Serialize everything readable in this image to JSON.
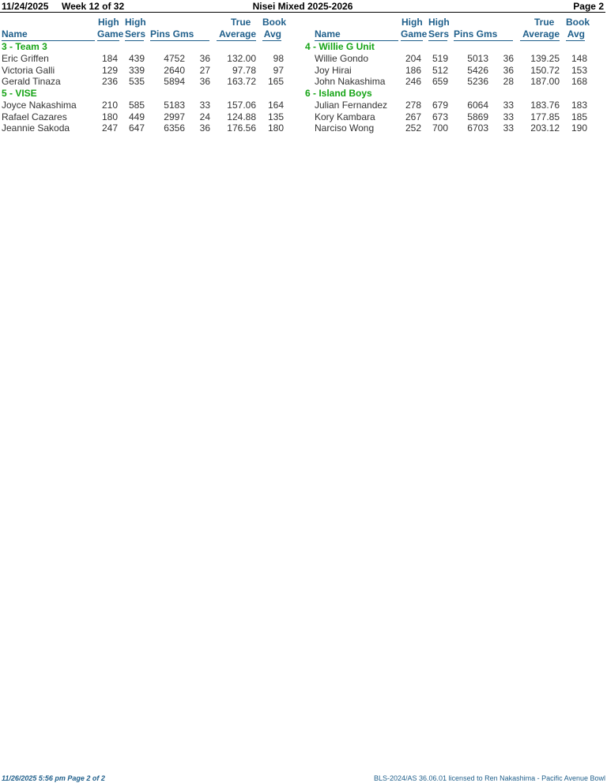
{
  "header": {
    "date": "11/24/2025",
    "week": "Week 12 of 32",
    "league": "Nisei Mixed 2025-2026",
    "page": "Page 2"
  },
  "columns_header": {
    "name": "Name",
    "high_game_1": "High",
    "high_game_2": "Game",
    "high_sers_1": "High",
    "high_sers_2": "Sers",
    "pins_gms": "Pins  Gms",
    "true_avg_1": "True",
    "true_avg_2": "Average",
    "book_avg_1": "Book",
    "book_avg_2": "Avg"
  },
  "left": {
    "teams": [
      {
        "title": "3 - Team 3",
        "players": [
          {
            "name": "Eric Griffen",
            "hg": "184",
            "hs": "439",
            "pins": "4752",
            "gms": "36",
            "avg": "132.00",
            "book": "98"
          },
          {
            "name": "Victoria Galli",
            "hg": "129",
            "hs": "339",
            "pins": "2640",
            "gms": "27",
            "avg": "97.78",
            "book": "97"
          },
          {
            "name": "Gerald Tinaza",
            "hg": "236",
            "hs": "535",
            "pins": "5894",
            "gms": "36",
            "avg": "163.72",
            "book": "165"
          }
        ]
      },
      {
        "title": "5 - VISE",
        "players": [
          {
            "name": "Joyce Nakashima",
            "hg": "210",
            "hs": "585",
            "pins": "5183",
            "gms": "33",
            "avg": "157.06",
            "book": "164"
          },
          {
            "name": "Rafael Cazares",
            "hg": "180",
            "hs": "449",
            "pins": "2997",
            "gms": "24",
            "avg": "124.88",
            "book": "135"
          },
          {
            "name": "Jeannie Sakoda",
            "hg": "247",
            "hs": "647",
            "pins": "6356",
            "gms": "36",
            "avg": "176.56",
            "book": "180"
          }
        ]
      }
    ]
  },
  "right": {
    "teams": [
      {
        "title": "4 - Willie G Unit",
        "players": [
          {
            "name": "Willie Gondo",
            "hg": "204",
            "hs": "519",
            "pins": "5013",
            "gms": "36",
            "avg": "139.25",
            "book": "148"
          },
          {
            "name": "Joy Hirai",
            "hg": "186",
            "hs": "512",
            "pins": "5426",
            "gms": "36",
            "avg": "150.72",
            "book": "153"
          },
          {
            "name": "John Nakashima",
            "hg": "246",
            "hs": "659",
            "pins": "5236",
            "gms": "28",
            "avg": "187.00",
            "book": "168"
          }
        ]
      },
      {
        "title": "6 - Island Boys",
        "players": [
          {
            "name": "Julian Fernandez",
            "hg": "278",
            "hs": "679",
            "pins": "6064",
            "gms": "33",
            "avg": "183.76",
            "book": "183"
          },
          {
            "name": "Kory Kambara",
            "hg": "267",
            "hs": "673",
            "pins": "5869",
            "gms": "33",
            "avg": "177.85",
            "book": "185"
          },
          {
            "name": "Narciso Wong",
            "hg": "252",
            "hs": "700",
            "pins": "6703",
            "gms": "33",
            "avg": "203.12",
            "book": "190"
          }
        ]
      }
    ]
  },
  "footer": {
    "left": "11/26/2025  5:56 pm  Page 2 of 2",
    "right": "BLS-2024/AS 36.06.01 licensed to Ren Nakashima - Pacific Avenue Bowl"
  }
}
